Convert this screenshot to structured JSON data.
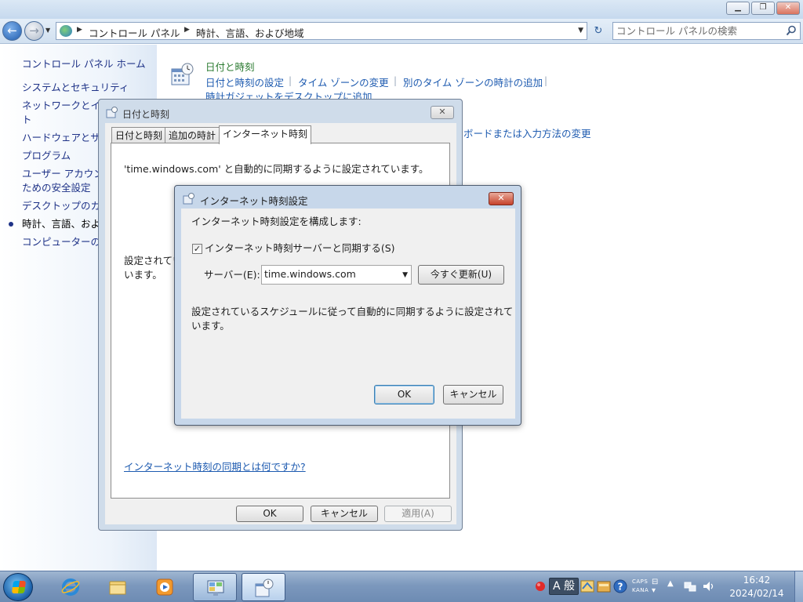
{
  "explorer": {
    "address": {
      "crumbs": [
        "コントロール パネル",
        "時計、言語、および地域"
      ]
    },
    "search": {
      "placeholder": "コントロール パネルの検索"
    },
    "sidebar": {
      "home": "コントロール パネル ホーム",
      "items": [
        "システムとセキュリティ",
        "ネットワークとイ",
        "ト",
        "ハードウェアとサ",
        "プログラム",
        "ユーザー アカウン",
        "ための安全設定",
        "デスクトップのカ",
        "時計、言語、およ",
        "コンピューターの"
      ]
    },
    "content": {
      "title": "日付と時刻",
      "links": [
        "日付と時刻の設定",
        "タイム ゾーンの変更",
        "別のタイム ゾーンの時計の追加"
      ],
      "gadget_link": "時計ガジェットをデスクトップに追加",
      "keyboard_link": "ボードまたは入力方法の変更"
    }
  },
  "date_time_dialog": {
    "title": "日付と時刻",
    "tabs": [
      "日付と時刻",
      "追加の時計",
      "インターネット時刻"
    ],
    "active_tab": "インターネット時刻",
    "sync_status": "'time.windows.com' と自動的に同期するように設定されています。",
    "schedule_line1": "設定されてい",
    "schedule_line2": "います。",
    "help_link": "インターネット時刻の同期とは何ですか?",
    "buttons": {
      "ok": "OK",
      "cancel": "キャンセル",
      "apply": "適用(A)"
    }
  },
  "internet_time_dialog": {
    "title": "インターネット時刻設定",
    "header": "インターネット時刻設定を構成します:",
    "sync_checkbox_label": "インターネット時刻サーバーと同期する(S)",
    "sync_checked": true,
    "server_label": "サーバー(E):",
    "server_value": "time.windows.com",
    "update_button": "今すぐ更新(U)",
    "schedule_line1": "設定されているスケジュールに従って自動的に同期するように設定されて",
    "schedule_line2": "います。",
    "buttons": {
      "ok": "OK",
      "cancel": "キャンセル"
    }
  },
  "taskbar": {
    "ime_mode": "A",
    "ime_kanji": "般",
    "caps": "CAPS",
    "kana": "KANA",
    "time": "16:42",
    "date": "2024/02/14"
  },
  "colors": {
    "link": "#1e5bb0",
    "sidebar_link": "#1e3287",
    "category_title": "#2a7a30",
    "taskbar": "#7c98bd"
  },
  "icons": [
    "back-arrow-icon",
    "forward-arrow-icon",
    "control-panel-icon",
    "refresh-icon",
    "search-icon",
    "clock-calendar-icon",
    "close-icon",
    "windows-start-icon",
    "internet-explorer-icon",
    "folder-icon",
    "media-player-icon",
    "control-panel-icon",
    "date-time-icon",
    "volume-icon",
    "network-icon",
    "help-icon"
  ]
}
